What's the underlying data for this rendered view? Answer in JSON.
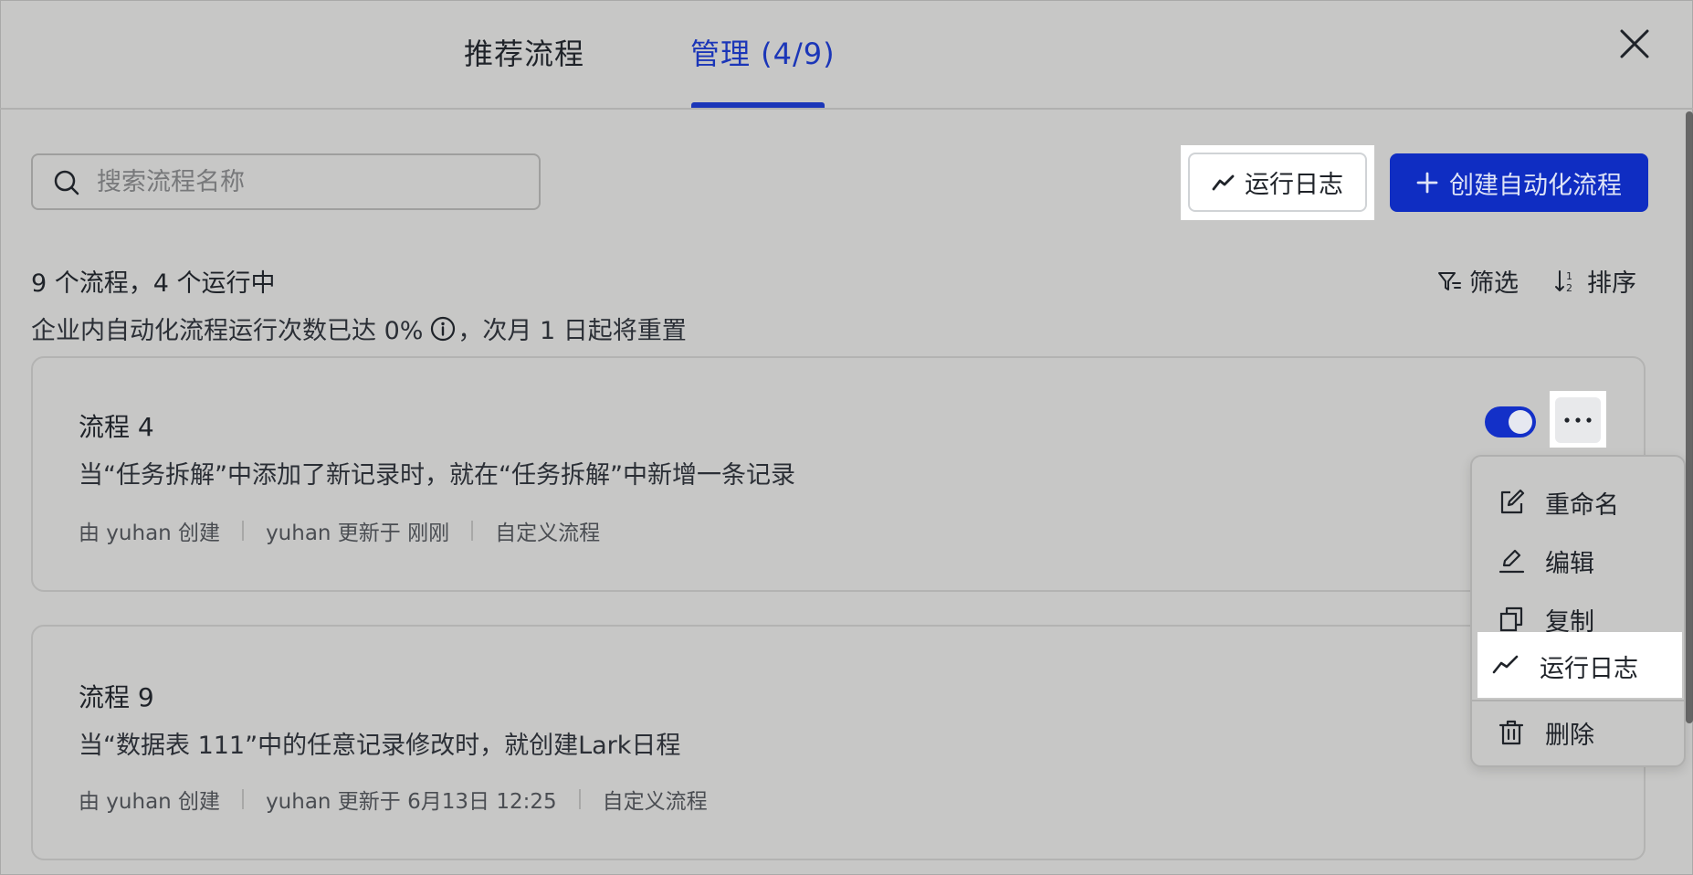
{
  "header": {
    "tabs": [
      {
        "label": "推荐流程",
        "active": false
      },
      {
        "label": "管理 (4/9)",
        "active": true
      }
    ],
    "accent_color": "#1b36b8"
  },
  "toolbar": {
    "search_placeholder": "搜索流程名称",
    "log_label": "运行日志",
    "create_label": "创建自动化流程"
  },
  "summary": {
    "count_text": "9 个流程，4 个运行中",
    "quota_before": "企业内自动化流程运行次数已达 0%",
    "quota_after": "，次月 1 日起将重置",
    "filter_label": "筛选",
    "sort_label": "排序"
  },
  "flows": [
    {
      "title": "流程 4",
      "description": "当“任务拆解”中添加了新记录时，就在“任务拆解”中新增一条记录",
      "creator": "由 yuhan 创建",
      "updated": "yuhan 更新于 刚刚",
      "type": "自定义流程",
      "enabled": true
    },
    {
      "title": "流程 9",
      "description": "当“数据表 111”中的任意记录修改时，就创建Lark日程",
      "creator": "由 yuhan 创建",
      "updated": "yuhan 更新于 6月13日 12:25",
      "type": "自定义流程"
    }
  ],
  "menu": {
    "items": [
      {
        "label": "重命名",
        "icon": "rename-icon"
      },
      {
        "label": "编辑",
        "icon": "edit-icon"
      },
      {
        "label": "复制",
        "icon": "copy-icon"
      },
      {
        "label": "运行日志",
        "icon": "log-icon",
        "highlighted": true
      },
      {
        "label": "删除",
        "icon": "trash-icon"
      }
    ]
  }
}
